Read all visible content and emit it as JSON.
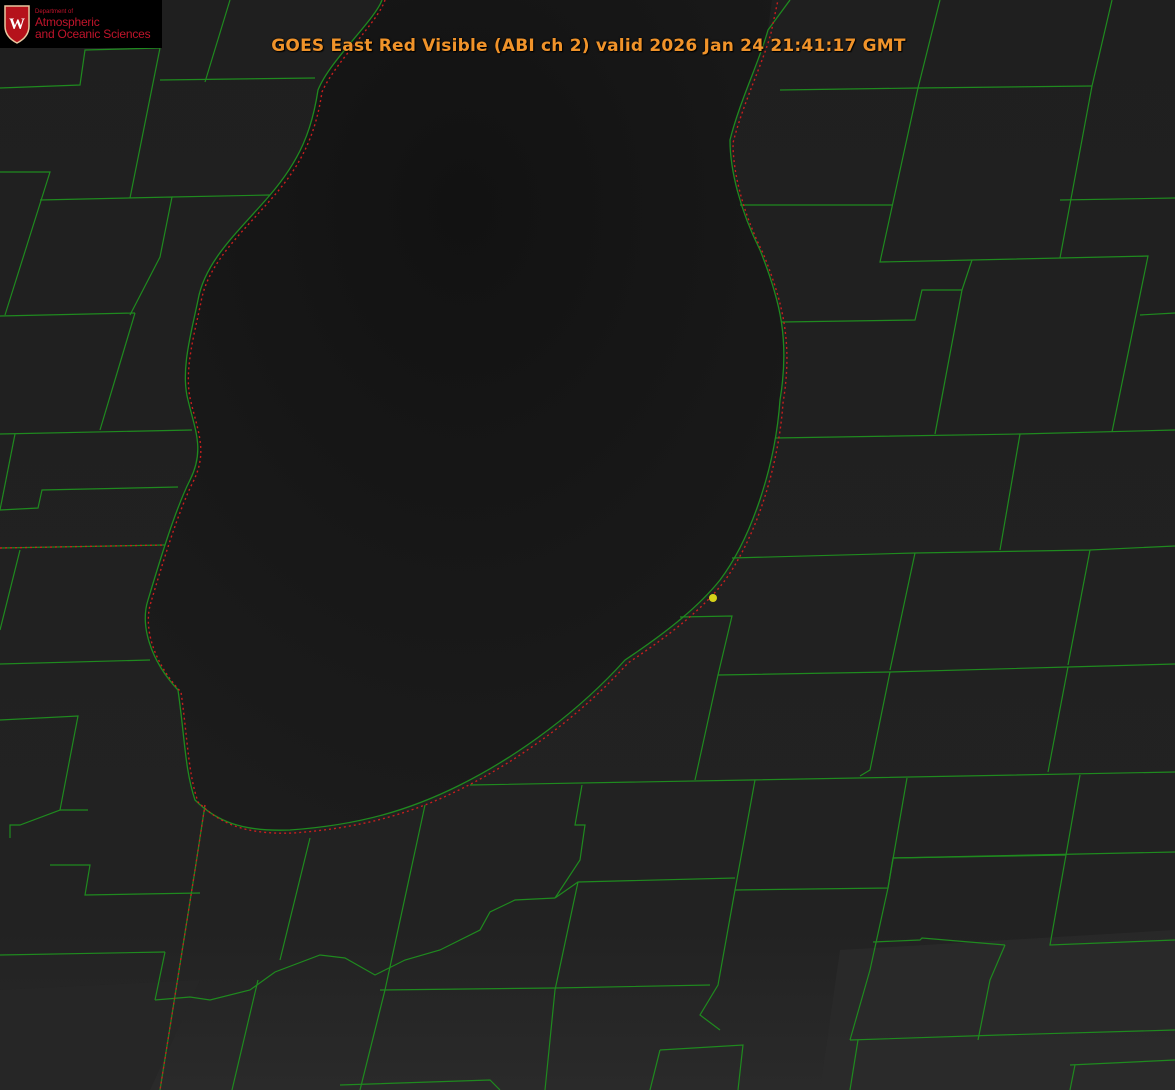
{
  "title": "GOES East Red Visible (ABI ch 2) valid 2026 Jan 24 21:41:17 GMT",
  "logo": {
    "department_small": "Department of",
    "line1": "Atmospheric",
    "line2": "and Oceanic Sciences",
    "seal_letter": "W"
  },
  "colors": {
    "background": "#202020",
    "lake": "#181818",
    "county_lines": "#1f8a1f",
    "state_lines": "#c81e1e",
    "marker": "#d6d21a",
    "title": "#f0932a",
    "logo_red": "#c0142b"
  },
  "map": {
    "product": "visible satellite imagery",
    "features": [
      "lake",
      "county-boundaries",
      "state-boundary-dotted",
      "station-marker"
    ]
  }
}
